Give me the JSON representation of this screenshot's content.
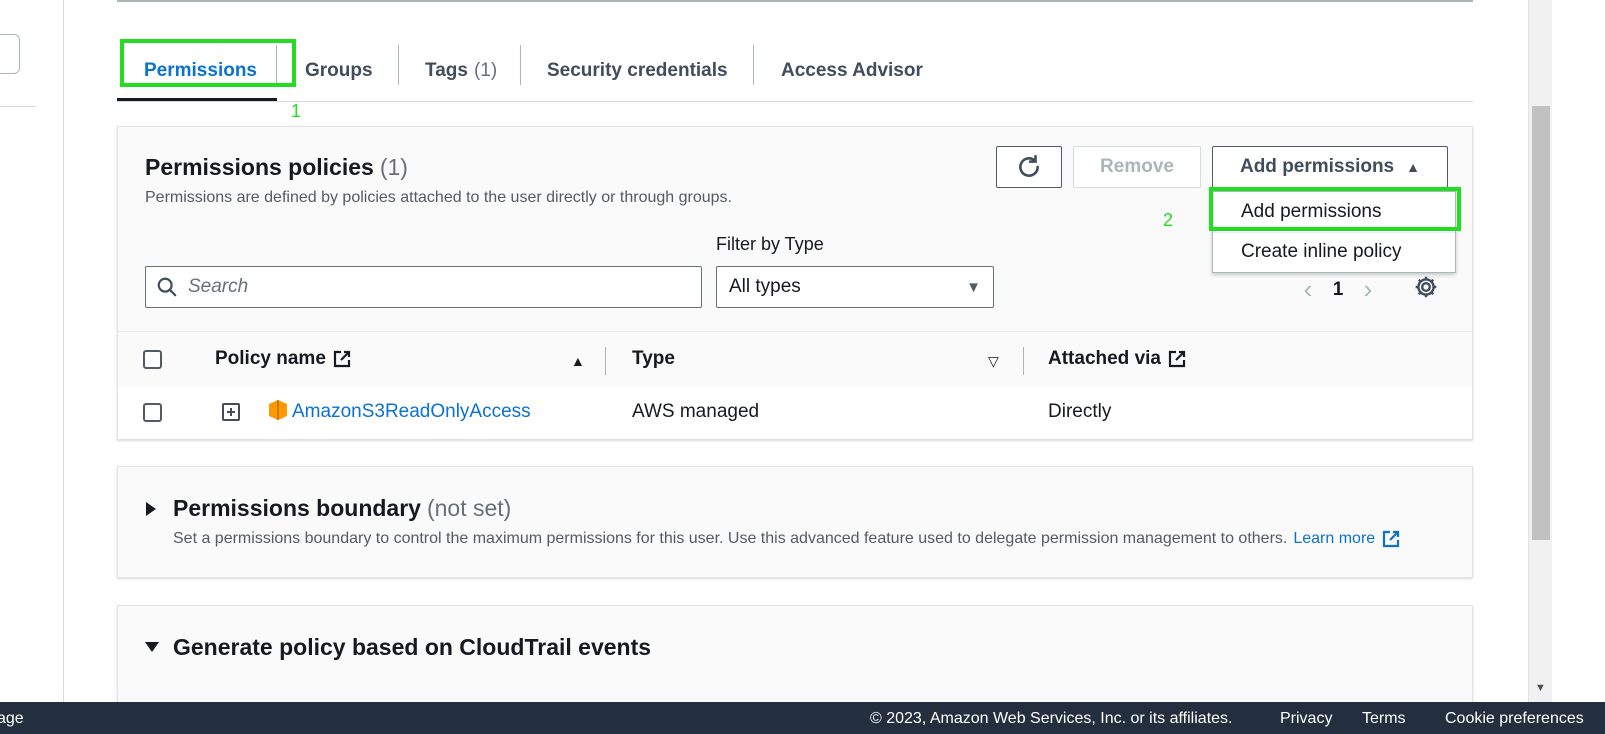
{
  "tabs": [
    {
      "label": "Permissions",
      "count": "",
      "active": true
    },
    {
      "label": "Groups",
      "count": ""
    },
    {
      "label": "Tags",
      "count": "(1)"
    },
    {
      "label": "Security credentials",
      "count": ""
    },
    {
      "label": "Access Advisor",
      "count": ""
    }
  ],
  "annotations": {
    "step1": "1",
    "step2": "2",
    "highlight_color": "#22dd22"
  },
  "permissions_policies": {
    "title": "Permissions policies",
    "count": "(1)",
    "description": "Permissions are defined by policies attached to the user directly or through groups.",
    "refresh_icon": "refresh-icon",
    "remove_label": "Remove",
    "add_permissions_label": "Add permissions",
    "dropdown_items": [
      "Add permissions",
      "Create inline policy"
    ],
    "filter_label": "Filter by Type",
    "search_placeholder": "Search",
    "filter_value": "All types",
    "page": "1",
    "columns": {
      "policy_name": "Policy name",
      "type": "Type",
      "attached_via": "Attached via"
    },
    "rows": [
      {
        "policy_name": "AmazonS3ReadOnlyAccess",
        "type": "AWS managed",
        "attached_via": "Directly"
      }
    ]
  },
  "permissions_boundary": {
    "title": "Permissions boundary",
    "status": "(not set)",
    "description": "Set a permissions boundary to control the maximum permissions for this user. Use this advanced feature used to delegate permission management to others.",
    "learn_more": "Learn more"
  },
  "generate_policy": {
    "title": "Generate policy based on CloudTrail events"
  },
  "footer": {
    "left_fragment": "age",
    "copyright": "© 2023, Amazon Web Services, Inc. or its affiliates.",
    "privacy": "Privacy",
    "terms": "Terms",
    "cookies": "Cookie preferences"
  },
  "colors": {
    "link": "#0972d3",
    "footer_bg": "#232f3e",
    "s3_icon": "#f90"
  }
}
